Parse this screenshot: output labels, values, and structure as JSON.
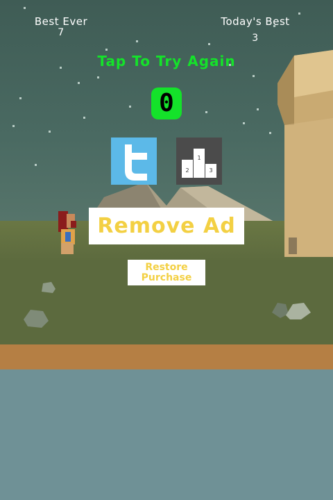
{
  "hud": {
    "best_ever_label": "Best Ever",
    "best_ever_value": "7",
    "todays_best_label": "Today's Best",
    "todays_best_value": "3"
  },
  "game_over": {
    "tap_text": "Tap To Try Again",
    "score": "0"
  },
  "buttons": {
    "remove_ad": "Remove Ad",
    "restore_line1": "Restore",
    "restore_line2": "Purchase"
  },
  "leaderboard": {
    "place1": "1",
    "place2": "2",
    "place3": "3"
  },
  "colors": {
    "accent_green": "#14e22a",
    "ad_text_yellow": "#f3d043",
    "twitter_blue": "#5cb9e8",
    "leaderboard_gray": "#4b4b4b"
  },
  "icons": {
    "twitter": "twitter-icon",
    "leaderboard": "leaderboard-podium-icon"
  }
}
